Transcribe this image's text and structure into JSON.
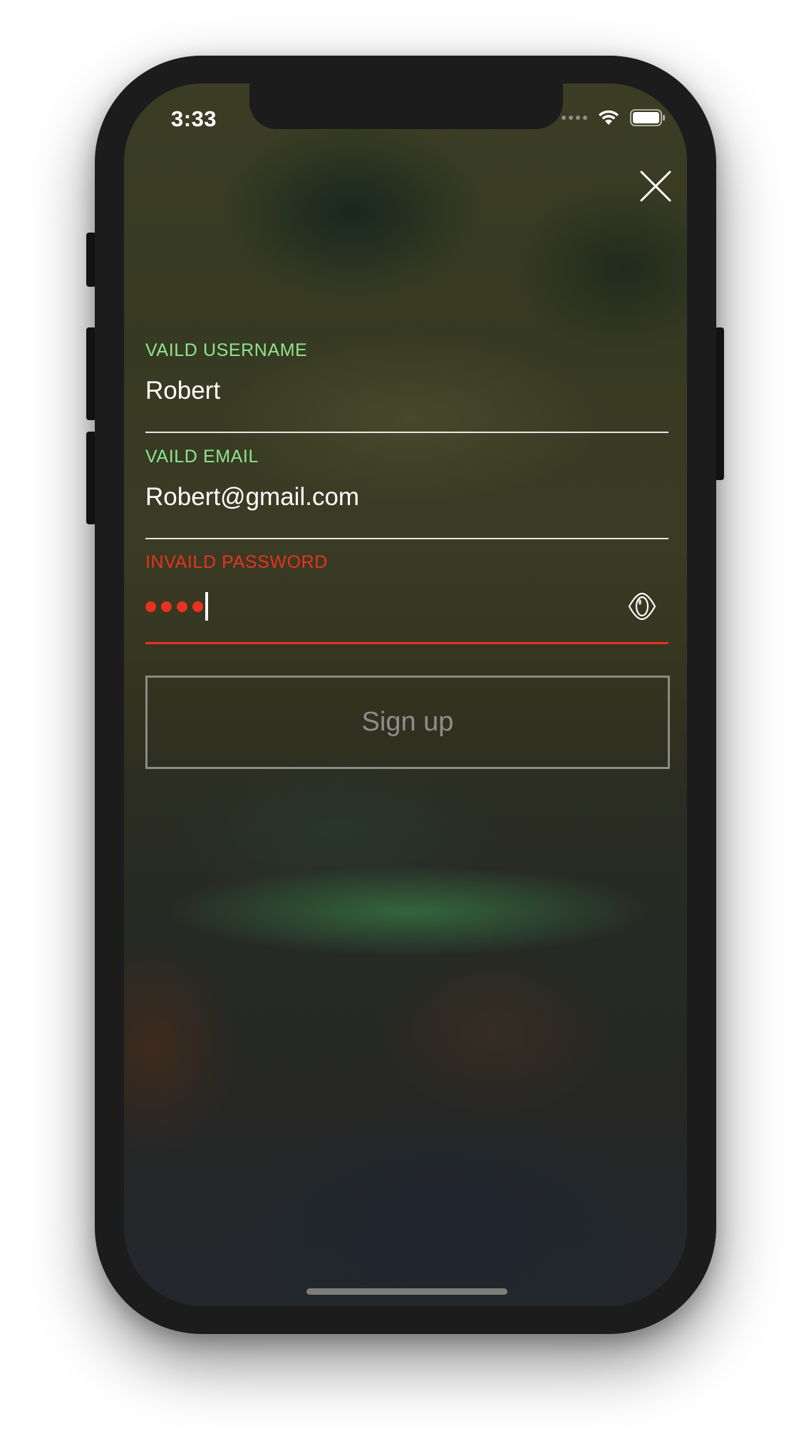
{
  "status_bar": {
    "time": "3:33",
    "signal_icon": "signal-dots-icon",
    "wifi_icon": "wifi-icon",
    "battery_icon": "battery-icon"
  },
  "close_icon": "close-icon",
  "form": {
    "username": {
      "label": "VAILD USERNAME",
      "value": "Robert",
      "state": "valid"
    },
    "email": {
      "label": "VAILD EMAIL",
      "value": "Robert@gmail.com",
      "state": "valid"
    },
    "password": {
      "label": "INVAILD PASSWORD",
      "masked_length": 4,
      "state": "invalid",
      "toggle_icon": "eye-icon"
    },
    "submit_label": "Sign up"
  },
  "colors": {
    "valid": "#8fe58f",
    "invalid": "#e8321f",
    "text": "#ffffff",
    "button_border": "#8a8a88",
    "button_text": "#8e8e8a"
  }
}
